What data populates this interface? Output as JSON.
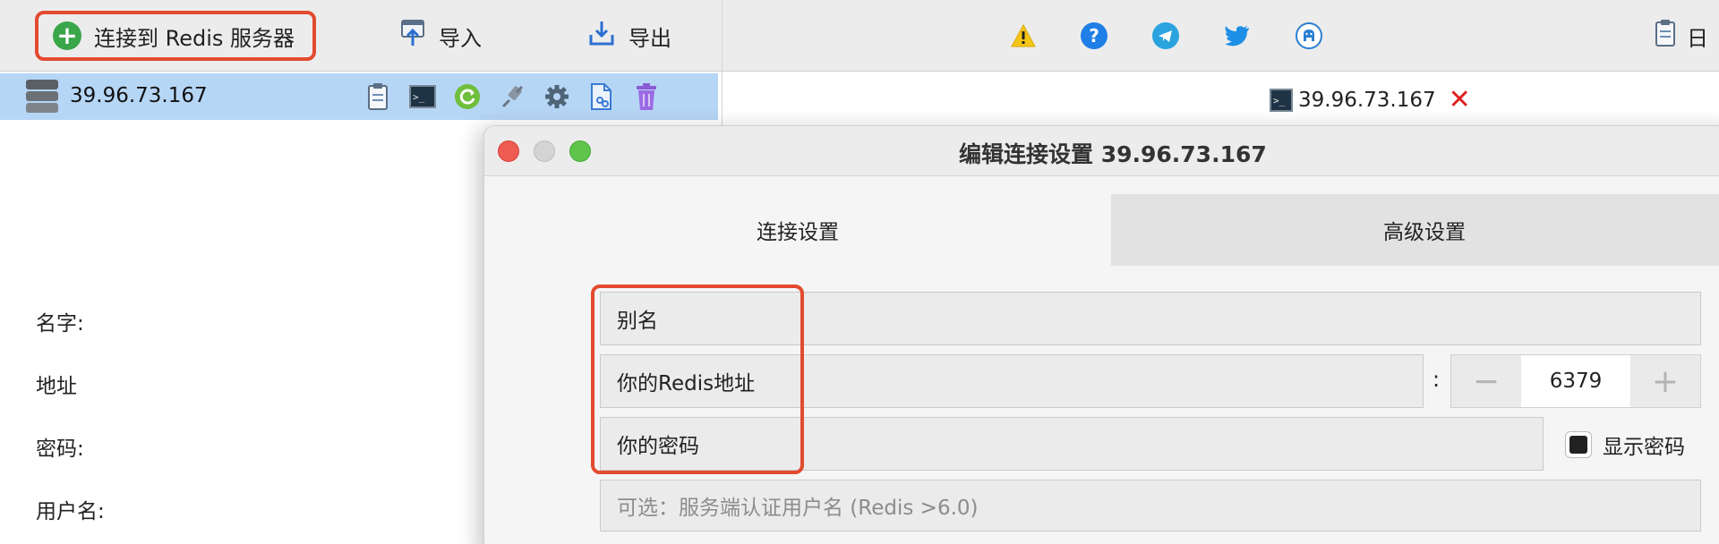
{
  "toolbar": {
    "connect_label": "连接到 Redis 服务器",
    "import_label": "导入",
    "export_label": "导出",
    "right_label": "日"
  },
  "server": {
    "name": "39.96.73.167"
  },
  "right_tab": {
    "label": "39.96.73.167"
  },
  "dialog": {
    "title": "编辑连接设置 39.96.73.167",
    "tabs": [
      "连接设置",
      "高级设置"
    ],
    "fields": {
      "name_label": "名字:",
      "name_value": "别名",
      "address_label": "地址",
      "address_value": "你的Redis地址",
      "colon": ":",
      "port": "6379",
      "password_label": "密码:",
      "password_value": "你的密码",
      "show_password": "显示密码",
      "username_label": "用户名:",
      "username_placeholder": "可选：服务端认证用户名 (Redis >6.0)"
    }
  },
  "colors": {
    "highlight": "#e34b2f",
    "selected_row": "#b6d6f6",
    "add_green": "#3aa64a",
    "close_red": "#e02020"
  },
  "icons": [
    "plus-circle-icon",
    "import-icon",
    "export-icon",
    "warning-icon",
    "help-icon",
    "telegram-icon",
    "twitter-icon",
    "github-icon",
    "clipboard-icon",
    "database-icon",
    "terminal-icon",
    "reload-icon",
    "disconnect-icon",
    "gear-icon",
    "copy-config-icon",
    "trash-icon",
    "close-icon"
  ]
}
